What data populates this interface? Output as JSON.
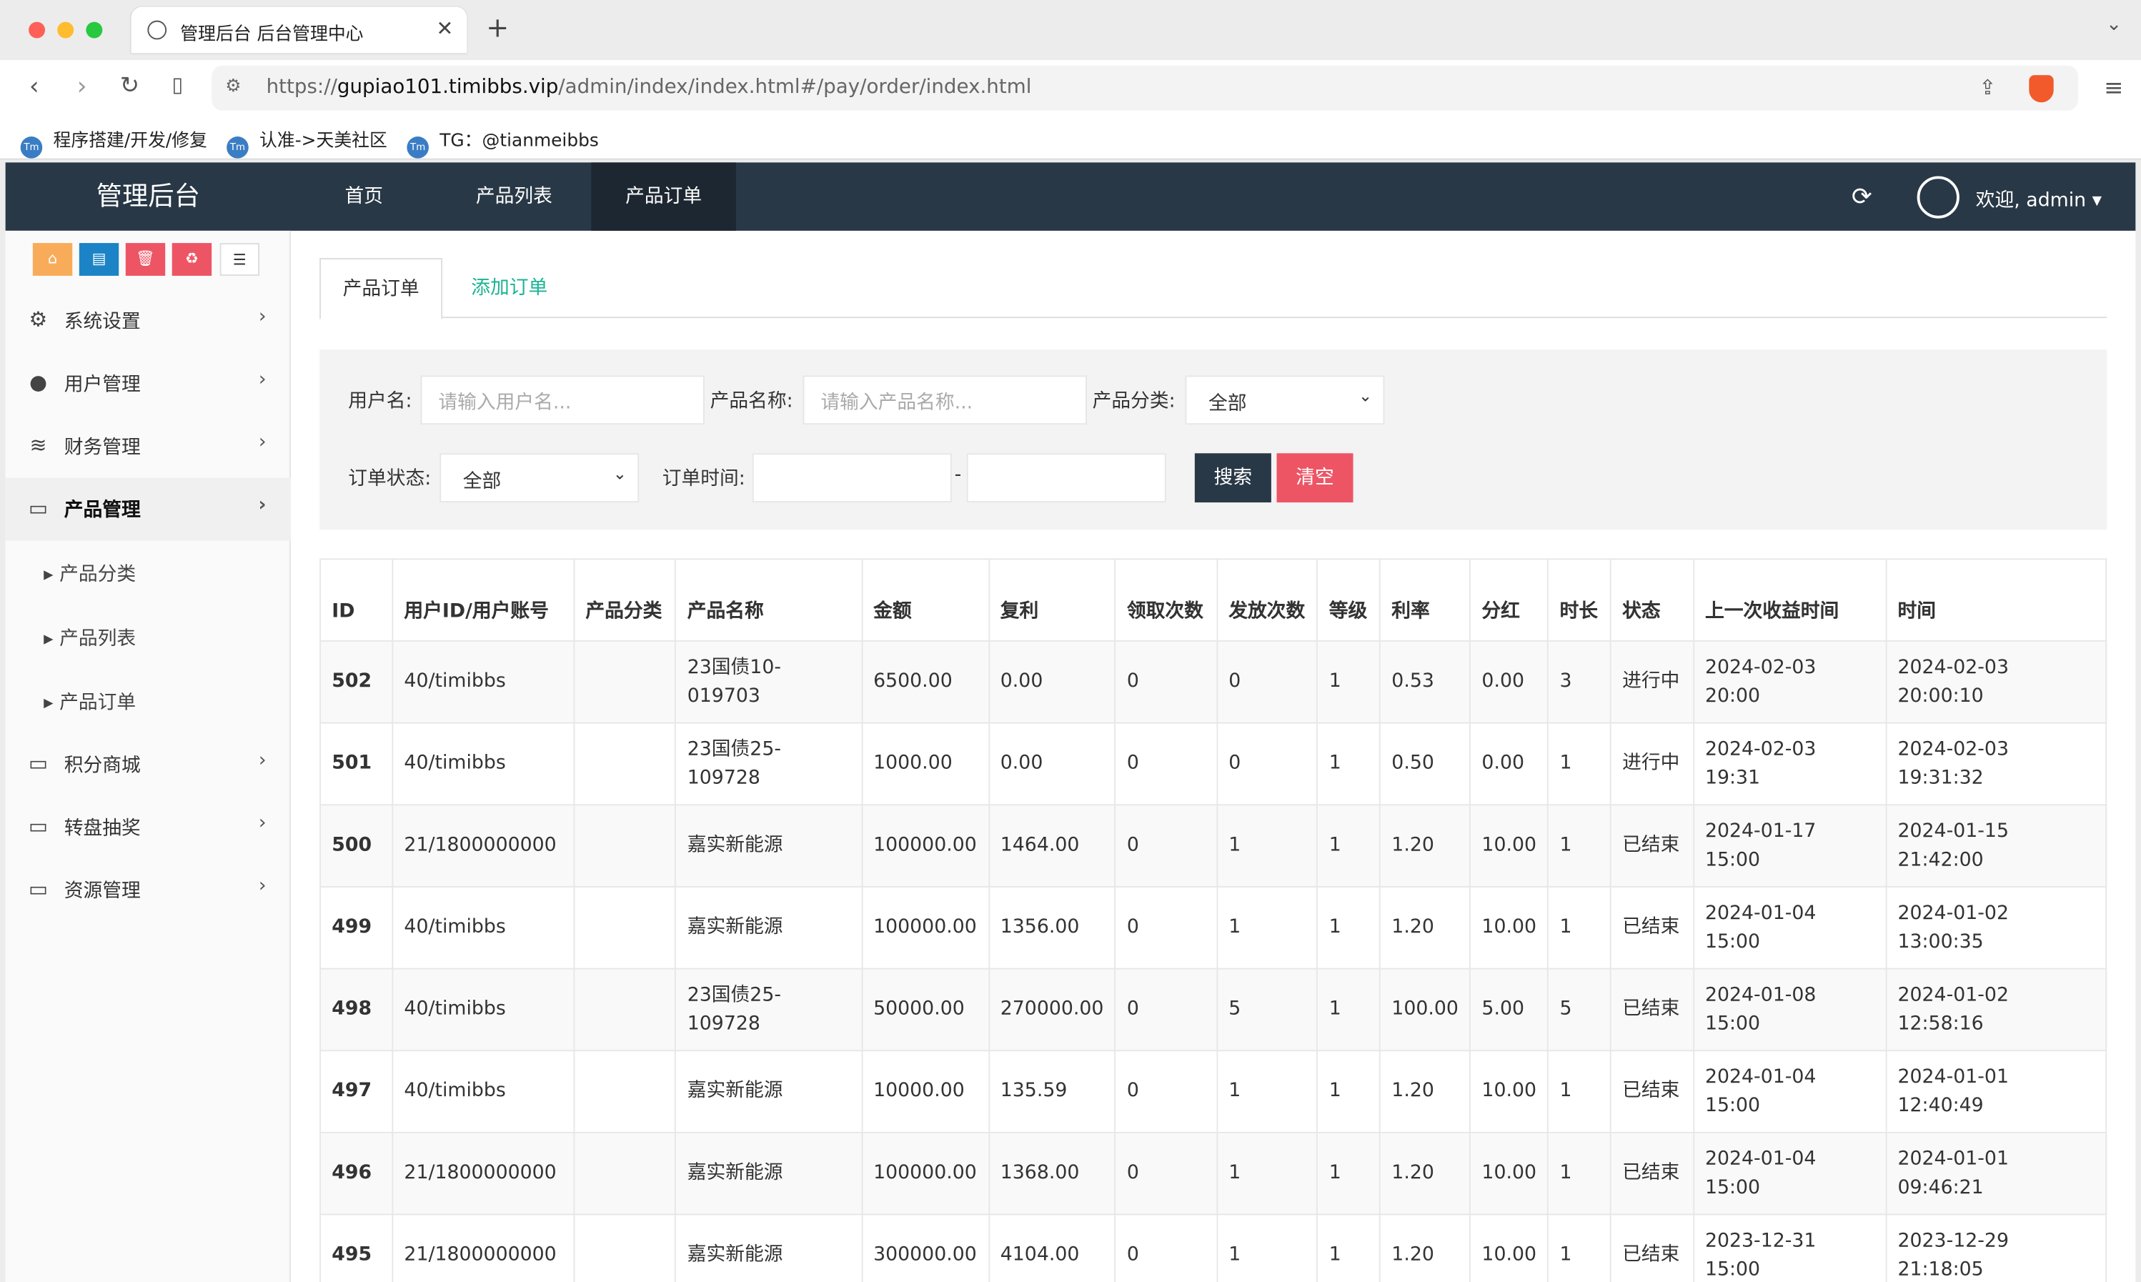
{
  "browser": {
    "tab_title": "管理后台 后台管理中心",
    "url_scheme": "https://",
    "url_host": "gupiao101.timibbs.vip",
    "url_path": "/admin/index/index.html#/pay/order/index.html",
    "bookmarks": [
      "程序搭建/开发/修复",
      "认准->天美社区",
      "TG：@tianmeibbs"
    ]
  },
  "header": {
    "brand": "管理后台",
    "nav": [
      "首页",
      "产品列表",
      "产品订单"
    ],
    "welcome": "欢迎, admin ▾"
  },
  "sidebar": {
    "items": [
      "系统设置",
      "用户管理",
      "财务管理",
      "产品管理"
    ],
    "sub_items": [
      "产品分类",
      "产品列表",
      "产品订单"
    ],
    "items_after": [
      "积分商城",
      "转盘抽奖",
      "资源管理"
    ]
  },
  "tabs": [
    "产品订单",
    "添加订单"
  ],
  "search": {
    "username_label": "用户名:",
    "username_placeholder": "请输入用户名...",
    "product_label": "产品名称:",
    "product_placeholder": "请输入产品名称...",
    "category_label": "产品分类:",
    "category_value": "全部",
    "status_label": "订单状态:",
    "status_value": "全部",
    "time_label": "订单时间:",
    "dash": "-",
    "search_btn": "搜索",
    "clear_btn": "清空"
  },
  "table": {
    "headers": [
      "ID",
      "用户ID/用户账号",
      "产品分类",
      "产品名称",
      "金额",
      "复利",
      "领取次数",
      "发放次数",
      "等级",
      "利率",
      "分红",
      "时长",
      "状态",
      "上一次收益时间",
      "时间"
    ],
    "rows": [
      [
        "502",
        "40/timibbs",
        "",
        "23国债10-019703",
        "6500.00",
        "0.00",
        "0",
        "0",
        "1",
        "0.53",
        "0.00",
        "3",
        "进行中",
        "2024-02-03 20:00",
        "2024-02-03 20:00:10"
      ],
      [
        "501",
        "40/timibbs",
        "",
        "23国债25-109728",
        "1000.00",
        "0.00",
        "0",
        "0",
        "1",
        "0.50",
        "0.00",
        "1",
        "进行中",
        "2024-02-03 19:31",
        "2024-02-03 19:31:32"
      ],
      [
        "500",
        "21/1800000000",
        "",
        "嘉实新能源",
        "100000.00",
        "1464.00",
        "0",
        "1",
        "1",
        "1.20",
        "10.00",
        "1",
        "已结束",
        "2024-01-17 15:00",
        "2024-01-15 21:42:00"
      ],
      [
        "499",
        "40/timibbs",
        "",
        "嘉实新能源",
        "100000.00",
        "1356.00",
        "0",
        "1",
        "1",
        "1.20",
        "10.00",
        "1",
        "已结束",
        "2024-01-04 15:00",
        "2024-01-02 13:00:35"
      ],
      [
        "498",
        "40/timibbs",
        "",
        "23国债25-109728",
        "50000.00",
        "270000.00",
        "0",
        "5",
        "1",
        "100.00",
        "5.00",
        "5",
        "已结束",
        "2024-01-08 15:00",
        "2024-01-02 12:58:16"
      ],
      [
        "497",
        "40/timibbs",
        "",
        "嘉实新能源",
        "10000.00",
        "135.59",
        "0",
        "1",
        "1",
        "1.20",
        "10.00",
        "1",
        "已结束",
        "2024-01-04 15:00",
        "2024-01-01 12:40:49"
      ],
      [
        "496",
        "21/1800000000",
        "",
        "嘉实新能源",
        "100000.00",
        "1368.00",
        "0",
        "1",
        "1",
        "1.20",
        "10.00",
        "1",
        "已结束",
        "2024-01-04 15:00",
        "2024-01-01 09:46:21"
      ],
      [
        "495",
        "21/1800000000",
        "",
        "嘉实新能源",
        "300000.00",
        "4104.00",
        "0",
        "1",
        "1",
        "1.20",
        "10.00",
        "1",
        "已结束",
        "2023-12-31 15:00",
        "2023-12-29 21:18:05"
      ]
    ]
  },
  "colors": {
    "header": "#293846",
    "accent": "#1ab394",
    "danger": "#ed5565"
  }
}
